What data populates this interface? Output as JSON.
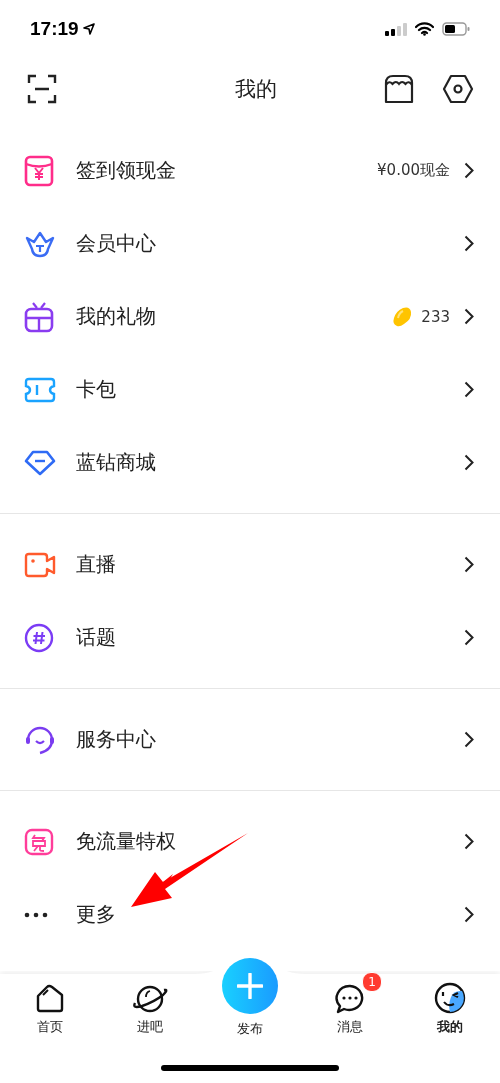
{
  "status_bar": {
    "time": "17:19"
  },
  "header": {
    "title": "我的"
  },
  "groups": [
    {
      "items": [
        {
          "label": "签到领现金",
          "detail": "¥0.00现金"
        },
        {
          "label": "会员中心"
        },
        {
          "label": "我的礼物",
          "detail": "233"
        },
        {
          "label": "卡包"
        },
        {
          "label": "蓝钻商城"
        }
      ]
    },
    {
      "items": [
        {
          "label": "直播"
        },
        {
          "label": "话题"
        }
      ]
    },
    {
      "items": [
        {
          "label": "服务中心"
        }
      ]
    },
    {
      "items": [
        {
          "label": "免流量特权"
        },
        {
          "label": "更多"
        }
      ]
    }
  ],
  "tab_bar": {
    "tabs": [
      {
        "kind": "tab",
        "label": "首页",
        "selected": false
      },
      {
        "kind": "tab",
        "label": "进吧",
        "selected": false
      },
      {
        "kind": "publish",
        "label": "发布",
        "selected": false
      },
      {
        "kind": "tab",
        "label": "消息",
        "selected": false,
        "badge": "1"
      },
      {
        "kind": "tab",
        "label": "我的",
        "selected": true
      }
    ]
  },
  "annotation": {
    "kind": "arrow"
  }
}
